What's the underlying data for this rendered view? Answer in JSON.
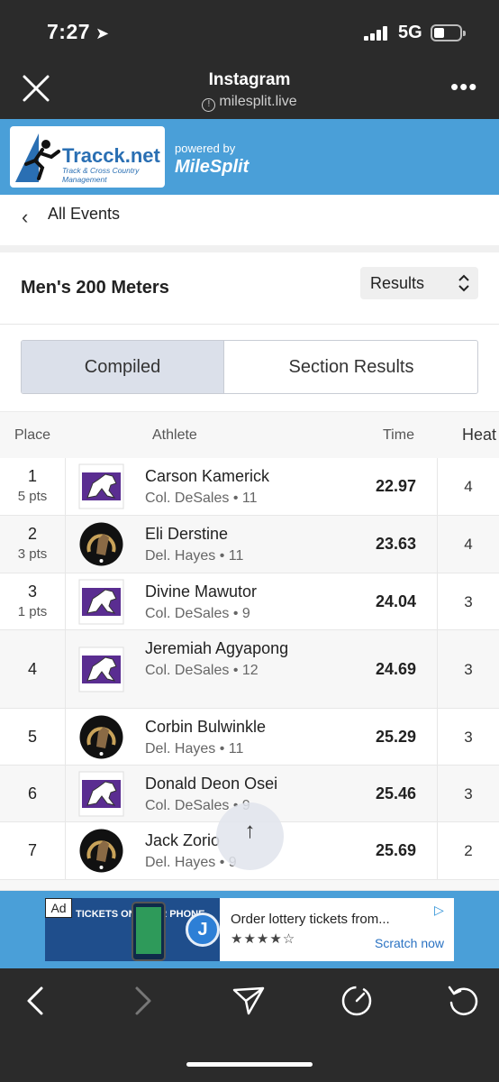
{
  "status_bar": {
    "time": "7:27",
    "network": "5G"
  },
  "app_header": {
    "title": "Instagram",
    "url": "milesplit.live"
  },
  "brand": {
    "logo_text": "Tracck.net",
    "logo_sub": "Track & Cross Country Management",
    "powered_by": "powered by",
    "partner": "MileSplit"
  },
  "nav": {
    "back_label": "All Events"
  },
  "event": {
    "title": "Men's 200 Meters",
    "view_select": "Results"
  },
  "tabs": {
    "compiled": "Compiled",
    "section_results": "Section Results",
    "active": "Compiled"
  },
  "table": {
    "headers": {
      "place": "Place",
      "athlete": "Athlete",
      "time": "Time",
      "heat": "Heat"
    },
    "rows": [
      {
        "place": "1",
        "pts": "5 pts",
        "name": "Carson Kamerick",
        "team": "Col. DeSales • 11",
        "time": "22.97",
        "heat": "4",
        "logo": "mustang"
      },
      {
        "place": "2",
        "pts": "3 pts",
        "name": "Eli Derstine",
        "team": "Del. Hayes • 11",
        "time": "23.63",
        "heat": "4",
        "logo": "horse-shoe"
      },
      {
        "place": "3",
        "pts": "1 pts",
        "name": "Divine Mawutor",
        "team": "Col. DeSales • 9",
        "time": "24.04",
        "heat": "3",
        "logo": "mustang"
      },
      {
        "place": "4",
        "pts": "",
        "name": "Jeremiah Agyapong",
        "team": "Col. DeSales • 12",
        "time": "24.69",
        "heat": "3",
        "logo": "mustang"
      },
      {
        "place": "5",
        "pts": "",
        "name": "Corbin Bulwinkle",
        "team": "Del. Hayes • 11",
        "time": "25.29",
        "heat": "3",
        "logo": "horse-shoe"
      },
      {
        "place": "6",
        "pts": "",
        "name": "Donald Deon Osei",
        "team": "Col. DeSales • 9",
        "time": "25.46",
        "heat": "3",
        "logo": "mustang"
      },
      {
        "place": "7",
        "pts": "",
        "name": "Jack Zorio",
        "team": "Del. Hayes • 9",
        "time": "25.69",
        "heat": "2",
        "logo": "horse-shoe"
      }
    ]
  },
  "scroll_top": "↑",
  "ad": {
    "tag": "Ad",
    "headline": "Order lottery tickets from...",
    "rating": "★★★★☆",
    "cta": "Scratch now",
    "image_text": "TICKETS ON YOUR PHONE",
    "brand_letter": "J"
  },
  "colors": {
    "brand_blue": "#4a9fd8",
    "chrome_dark": "#2b2b2b",
    "tab_active": "#dbe0ea",
    "desales_purple": "#5a2d91"
  }
}
